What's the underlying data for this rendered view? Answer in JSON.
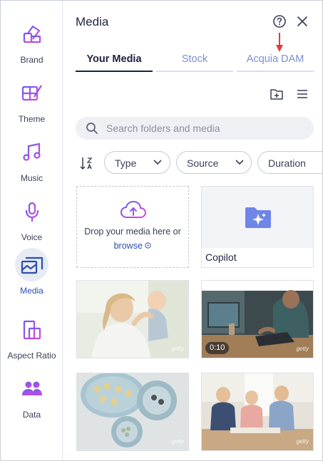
{
  "sidebar": {
    "items": [
      {
        "label": "Brand",
        "icon": "brand-palette-icon"
      },
      {
        "label": "Theme",
        "icon": "theme-brush-icon"
      },
      {
        "label": "Music",
        "icon": "music-note-icon"
      },
      {
        "label": "Voice",
        "icon": "microphone-icon"
      },
      {
        "label": "Media",
        "icon": "media-images-icon",
        "active": true
      },
      {
        "label": "Aspect Ratio",
        "icon": "aspect-ratio-icon"
      },
      {
        "label": "Data",
        "icon": "data-people-icon"
      }
    ]
  },
  "panel": {
    "title": "Media",
    "tabs": [
      {
        "label": "Your Media",
        "active": true
      },
      {
        "label": "Stock"
      },
      {
        "label": "Acquia DAM"
      }
    ]
  },
  "search": {
    "placeholder": "Search folders and media",
    "value": ""
  },
  "filters": [
    {
      "label": "Type"
    },
    {
      "label": "Source"
    },
    {
      "label": "Duration"
    }
  ],
  "upload": {
    "text": "Drop your media here or",
    "browse_label": "browse"
  },
  "folders": [
    {
      "label": "Copilot"
    }
  ],
  "media": [
    {
      "type": "image",
      "subject": "mother and baby",
      "watermark": "getty"
    },
    {
      "type": "video",
      "subject": "person typing on laptop",
      "duration": "0:10",
      "watermark": "getty"
    },
    {
      "type": "image",
      "subject": "plates of food",
      "watermark": "getty"
    },
    {
      "type": "image",
      "subject": "family at table",
      "watermark": "getty"
    }
  ],
  "colors": {
    "accent": "#2c4fae",
    "icon_gradient_start": "#7b5cf0",
    "icon_gradient_end": "#d24bd8",
    "annotation_arrow": "#e03b3b"
  }
}
